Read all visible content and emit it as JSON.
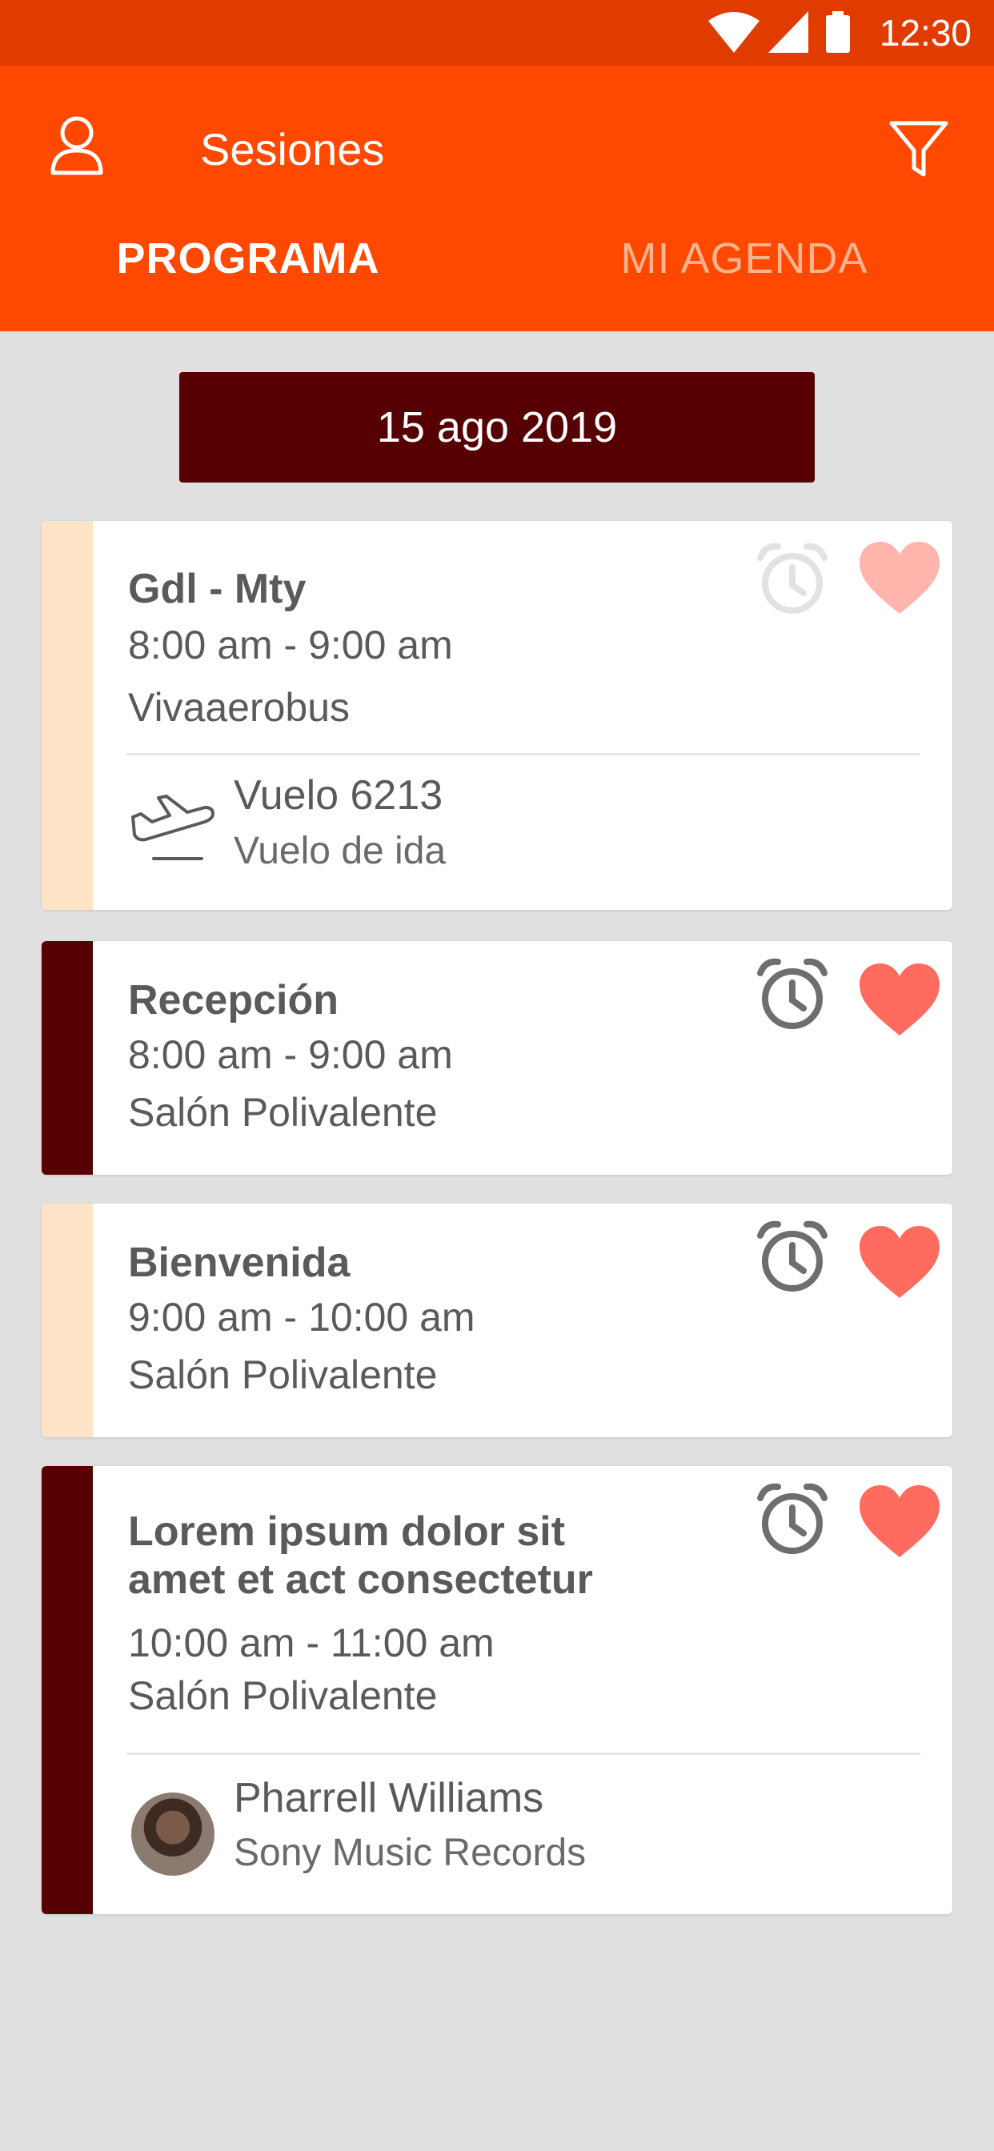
{
  "status_bar": {
    "time": "12:30",
    "icons": [
      "wifi-icon",
      "signal-icon",
      "battery-icon"
    ]
  },
  "header": {
    "title": "Sesiones",
    "left_icon": "user-icon",
    "right_icon": "filter-icon"
  },
  "tabs": [
    {
      "label": "PROGRAMA",
      "active": true
    },
    {
      "label": "MI AGENDA",
      "active": false
    }
  ],
  "date": "15 ago 2019",
  "colors": {
    "accent": "#ff4800",
    "status_bar": "#e03c00",
    "dark": "#560003",
    "light_stripe": "#ffe3c6",
    "heart": "#ff6b5e",
    "heart_light": "#ffb4ac"
  },
  "sessions": [
    {
      "title": "Gdl - Mty",
      "time": "8:00 am - 9:00 am",
      "place": "Vivaaerobus",
      "detail_icon": "airplane-icon",
      "detail_title": "Vuelo 6213",
      "detail_subtitle": "Vuelo de ida"
    },
    {
      "title": "Recepción",
      "time": "8:00 am - 9:00 am",
      "place": "Salón Polivalente"
    },
    {
      "title": "Bienvenida",
      "time": "9:00 am - 10:00 am",
      "place": "Salón Polivalente"
    },
    {
      "title_line1": "Lorem ipsum dolor sit",
      "title_line2": "amet et act consectetur",
      "time": "10:00 am - 11:00 am",
      "place": "Salón Polivalente",
      "speaker_name": "Pharrell Williams",
      "speaker_company": "Sony Music Records"
    }
  ]
}
